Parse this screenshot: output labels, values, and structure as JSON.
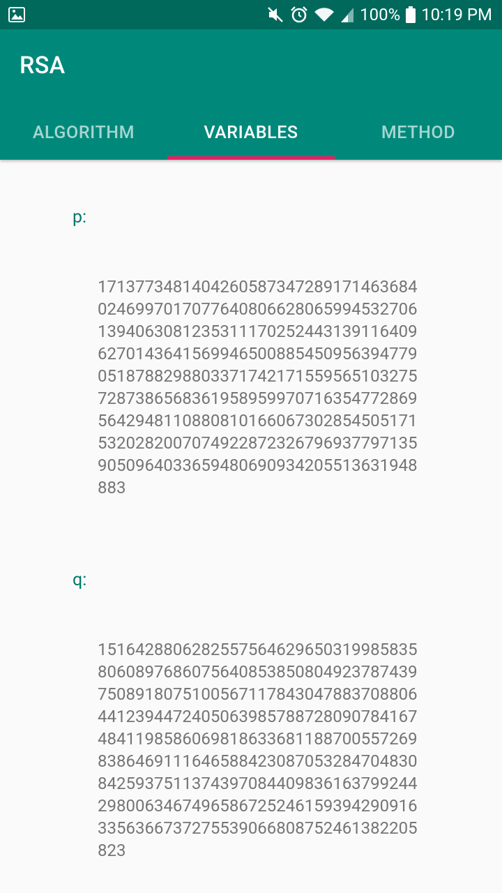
{
  "status_bar": {
    "battery": "100%",
    "time": "10:19 PM",
    "icons": [
      "gallery-icon",
      "mute-icon",
      "alarm-icon",
      "wifi-icon",
      "signal-icon",
      "battery-icon"
    ]
  },
  "app": {
    "title": "RSA",
    "colors": {
      "primary": "#00897b",
      "primary_dark": "#00695c",
      "accent": "#e91e63",
      "label": "#00796b",
      "value_text": "#757575",
      "background": "#fafafa"
    }
  },
  "tabs": [
    {
      "label": "ALGORITHM",
      "selected": false
    },
    {
      "label": "VARIABLES",
      "selected": true
    },
    {
      "label": "METHOD",
      "selected": false
    }
  ],
  "variables": {
    "p": {
      "label": "p:",
      "value": "171377348140426058734728917146368402469970170776408066280659945327061394063081235311170252443139116409627014364156994650088545095639477905187882988033717421715595651032757287386568361958959970716354772869564294811088081016606730285450517153202820070749228723267969377971359050964033659480690934205513631948883"
    },
    "q": {
      "label": "q:",
      "value": "151642880628255756462965031998583580608976860756408538508049237874397508918075100567117843047883708806441239447240506398578872809078416748411985860698186336811887005572698386469111646588423087053284704830842593751137439708440983616379924429800634674965867252461593942909163356366737275539066808752461382205823"
    }
  }
}
